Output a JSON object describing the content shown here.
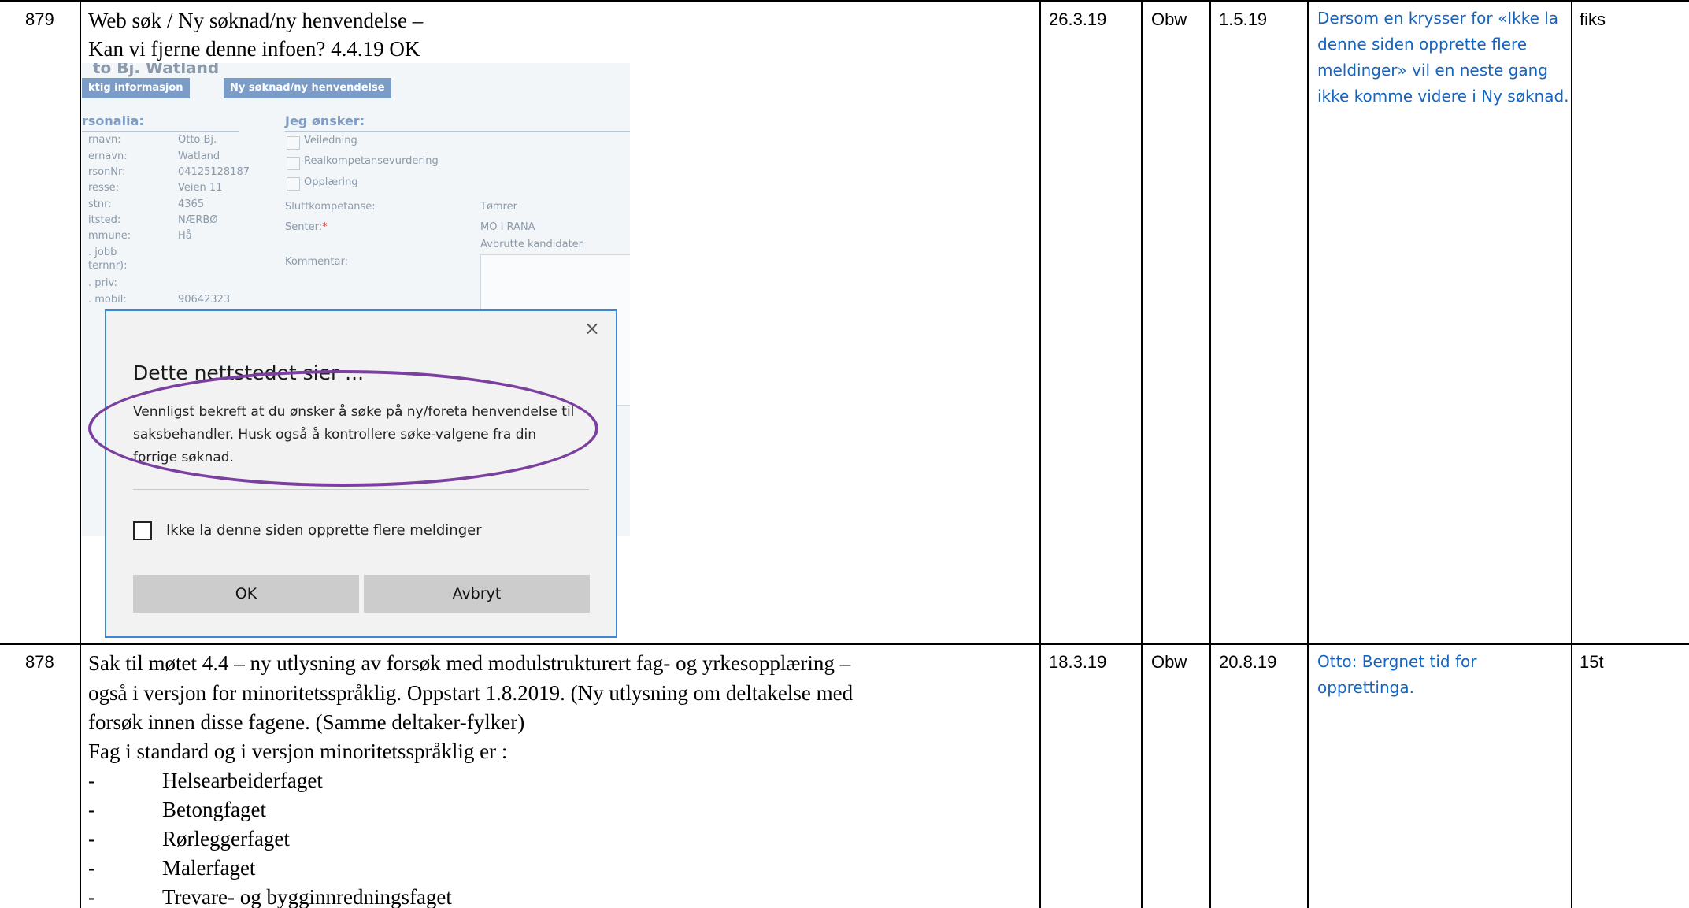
{
  "rows": [
    {
      "id": "879",
      "description_lines": [
        "Web søk / Ny søknad/ny henvendelse –",
        "Kan vi fjerne denne infoen?  4.4.19 OK"
      ],
      "date": "26.3.19",
      "owner": "Obw",
      "due": "1.5.19",
      "note": "Dersom en krysser for «Ikke la denne siden opprette flere meldinger» vil en neste gang ikke komme videre i Ny søknad.",
      "status": "fiks"
    },
    {
      "id": "878",
      "description_lines": [
        "Sak til møtet 4.4 – ny utlysning av forsøk med modulstrukturert fag- og yrkesopplæring –",
        "også i versjon for minoritetsspråklig. Oppstart 1.8.2019. (Ny utlysning om deltakelse med",
        "forsøk innen disse fagene. (Samme deltaker-fylker)",
        "Fag i standard og i versjon minoritetsspråklig er :"
      ],
      "list_items": [
        "Helsearbeiderfaget",
        "Betongfaget",
        "Rørleggerfaget",
        "Malerfaget",
        "Trevare- og bygginnredningsfaget"
      ],
      "list_bullet": "-",
      "date": "18.3.19",
      "owner": "Obw",
      "due": "20.8.19",
      "note": "Otto: Bergnet tid for opprettinga.",
      "status": "15t"
    }
  ],
  "screenshot": {
    "title_fragment": "to Bj. Watland",
    "tabs": [
      "ktig informasjon",
      "Ny søknad/ny henvendelse"
    ],
    "personalia_header": "rsonalia:",
    "onsker_header": "Jeg ønsker:",
    "labels": [
      "rnavn:",
      "ernavn:",
      "rsonNr:",
      "resse:",
      "stnr:",
      "itsted:",
      "mmune:",
      ". jobb",
      "ternnr):",
      ". priv:",
      ". mobil:"
    ],
    "values": [
      "Otto Bj.",
      "Watland",
      "04125128187",
      "Veien 11",
      "4365",
      "NÆRBØ",
      "Hå",
      "",
      "",
      "",
      "90642323"
    ],
    "options": [
      "Veiledning",
      "Realkompetansevurdering",
      "Opplæring"
    ],
    "sluttkompetanse_label": "Sluttkompetanse:",
    "sluttkompetanse_value": "Tømrer",
    "senter_label": "Senter:",
    "senter_required": "*",
    "senter_value": "MO I RANA",
    "avbrutte": "Avbrutte kandidater",
    "kommentar_label": "Kommentar:",
    "dialog": {
      "title": "Dette nettstedet sier ...",
      "message": "Vennligst bekreft at du ønsker å søke på ny/foreta henvendelse til saksbehandler. Husk også å kontrollere søke-valgene fra din forrige søknad.",
      "checkbox_label": "Ikke la denne siden opprette flere meldinger",
      "ok_label": "OK",
      "cancel_label": "Avbryt",
      "close_glyph": "×"
    }
  }
}
